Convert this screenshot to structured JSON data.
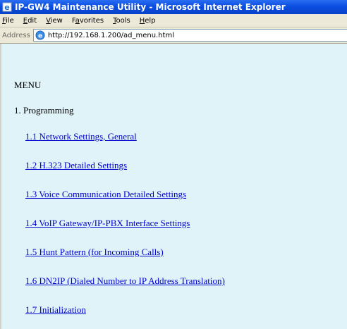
{
  "window": {
    "title": "IP-GW4 Maintenance Utility - Microsoft Internet Explorer"
  },
  "menubar": {
    "items": [
      "File",
      "Edit",
      "View",
      "Favorites",
      "Tools",
      "Help"
    ]
  },
  "addressbar": {
    "label": "Address",
    "url": "http://192.168.1.200/ad_menu.html"
  },
  "page": {
    "heading": "MENU",
    "section": "1. Programming",
    "links": [
      "1.1 Network Settings, General",
      "1.2 H.323 Detailed Settings",
      "1.3 Voice Communication Detailed Settings",
      "1.4 VoIP Gateway/IP-PBX Interface Settings",
      "1.5 Hunt Pattern (for Incoming Calls)",
      "1.6 DN2IP (Dialed Number to IP Address Translation)",
      "1.7 Initialization"
    ]
  }
}
